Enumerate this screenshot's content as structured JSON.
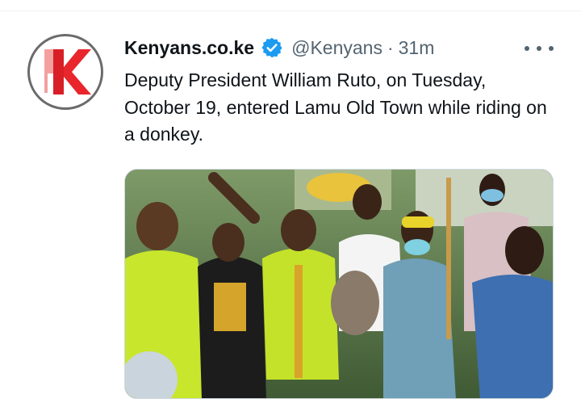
{
  "tweet": {
    "display_name": "Kenyans.co.ke",
    "handle": "@Kenyans",
    "separator": "·",
    "time": "31m",
    "text": "Deputy President William Ruto, on Tuesday, October 19, entered Lamu Old Town while riding on a donkey.",
    "avatar_icon": "kenyans-logo-icon",
    "verified_icon": "verified-badge-icon",
    "more_icon": "more-options-icon"
  },
  "colors": {
    "brand_red": "#e8262c",
    "verified_blue": "#1d9bf0",
    "text_primary": "#0f1419",
    "text_secondary": "#536471"
  }
}
